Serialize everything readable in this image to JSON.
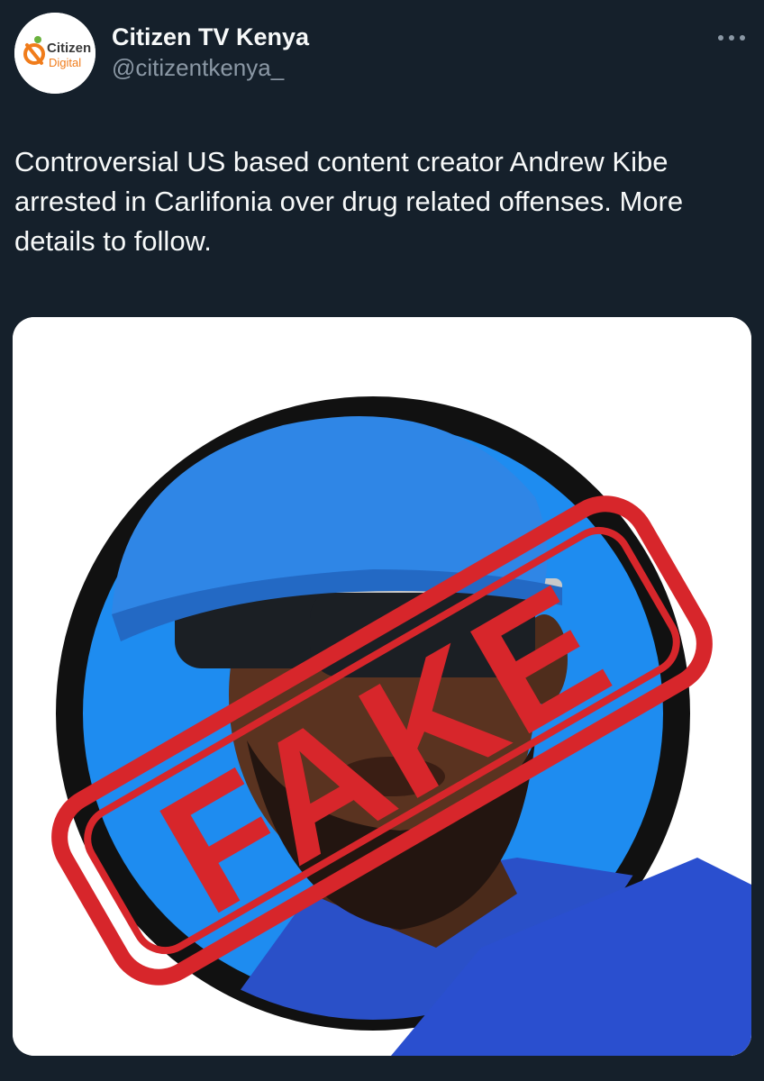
{
  "account": {
    "display_name": "Citizen TV Kenya",
    "handle": "@citizentkenya_",
    "avatar_logo_line1": "Citizen",
    "avatar_logo_line2": "Digital"
  },
  "tweet": {
    "text": "Controversial US based content creator Andrew Kibe arrested in Carlifonia over drug related offenses. More details to follow."
  },
  "media": {
    "stamp_text": "FAKE",
    "stamp_color": "#d7262b",
    "circle_color": "#1e8cf0",
    "cap_color": "#2f86e6"
  },
  "icons": {
    "more": "more-horizontal-icon",
    "avatar_logo": "citizen-digital-logo"
  },
  "colors": {
    "background": "#15202b",
    "primary_text": "#f7f9f9",
    "secondary_text": "#8b98a5",
    "logo_orange": "#f07c1b",
    "logo_green": "#6ab23e"
  }
}
